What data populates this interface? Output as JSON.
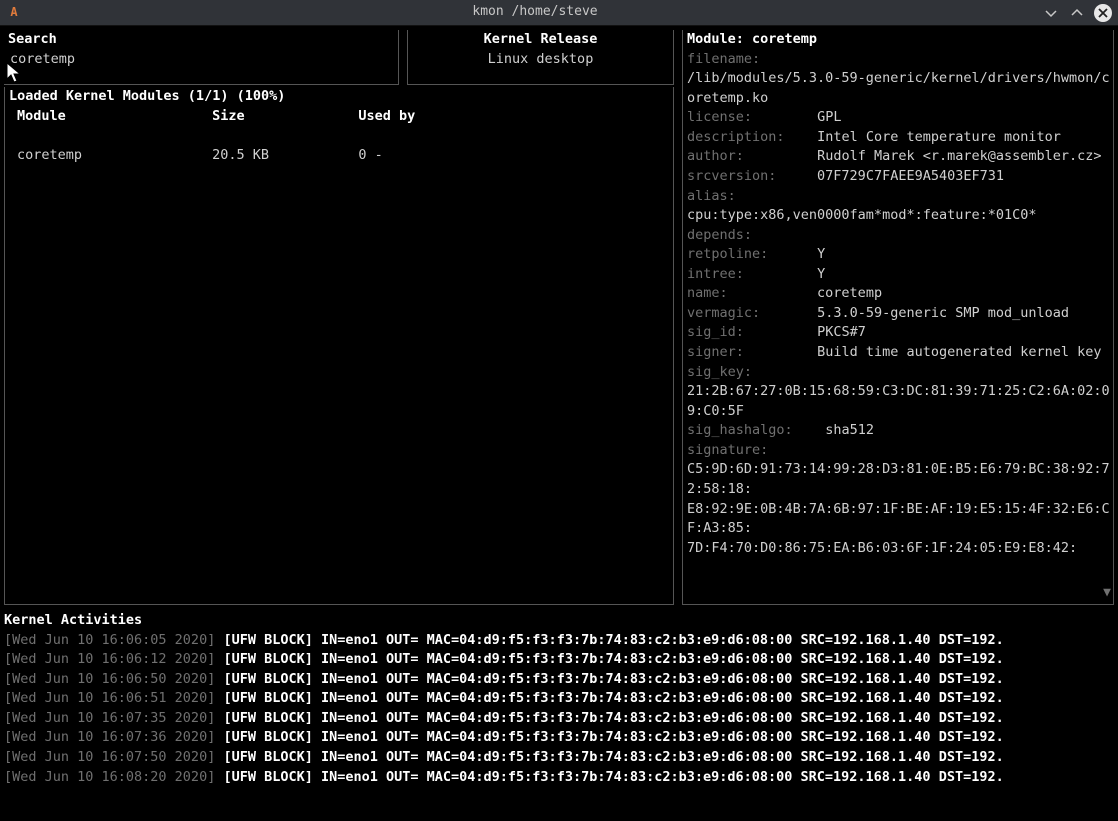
{
  "titlebar": {
    "app_icon_letter": "A",
    "title": "kmon /home/steve"
  },
  "search": {
    "label": "Search",
    "value": "coretemp"
  },
  "kernel_release": {
    "label": "Kernel Release",
    "value": "Linux desktop"
  },
  "modules_panel": {
    "label": "Loaded Kernel Modules (1/1) (100%)",
    "columns": {
      "c1": "Module",
      "c2": "Size",
      "c3": "Used by"
    },
    "rows": [
      {
        "name": "coretemp",
        "size": "20.5 KB",
        "used": "0 -"
      }
    ]
  },
  "module_detail": {
    "header": "Module: coretemp",
    "fields": {
      "filename_label": "filename:",
      "filename_value": "/lib/modules/5.3.0-59-generic/kernel/drivers/hwmon/coretemp.ko",
      "license_label": "license:",
      "license_value": "GPL",
      "description_label": "description:",
      "description_value": "Intel Core temperature monitor",
      "author_label": "author:",
      "author_value": "Rudolf Marek <r.marek@assembler.cz>",
      "srcversion_label": "srcversion:",
      "srcversion_value": "07F729C7FAEE9A5403EF731",
      "alias_label": "alias:",
      "alias_value": "cpu:type:x86,ven0000fam*mod*:feature:*01C0*",
      "depends_label": "depends:",
      "retpoline_label": "retpoline:",
      "retpoline_value": "Y",
      "intree_label": "intree:",
      "intree_value": "Y",
      "name_label": "name:",
      "name_value": "coretemp",
      "vermagic_label": "vermagic:",
      "vermagic_value": "5.3.0-59-generic SMP mod_unload",
      "sigid_label": "sig_id:",
      "sigid_value": "PKCS#7",
      "signer_label": "signer:",
      "signer_value": "Build time autogenerated kernel key",
      "sigkey_label": "sig_key:",
      "sigkey_value": "21:2B:67:27:0B:15:68:59:C3:DC:81:39:71:25:C2:6A:02:09:C0:5F",
      "sighash_label": "sig_hashalgo:",
      "sighash_value": "sha512",
      "signature_label": "signature:",
      "signature_value": "C5:9D:6D:91:73:14:99:28:D3:81:0E:B5:E6:79:BC:38:92:72:58:18:\nE8:92:9E:0B:4B:7A:6B:97:1F:BE:AF:19:E5:15:4F:32:E6:CF:A3:85:\n7D:F4:70:D0:86:75:EA:B6:03:6F:1F:24:05:E9:E8:42:"
    }
  },
  "activities": {
    "label": "Kernel Activities",
    "logs": [
      {
        "ts": "[Wed Jun 10 16:06:05 2020]",
        "msg": "[UFW BLOCK] IN=eno1 OUT= MAC=04:d9:f5:f3:f3:7b:74:83:c2:b3:e9:d6:08:00 SRC=192.168.1.40 DST=192."
      },
      {
        "ts": "[Wed Jun 10 16:06:12 2020]",
        "msg": "[UFW BLOCK] IN=eno1 OUT= MAC=04:d9:f5:f3:f3:7b:74:83:c2:b3:e9:d6:08:00 SRC=192.168.1.40 DST=192."
      },
      {
        "ts": "[Wed Jun 10 16:06:50 2020]",
        "msg": "[UFW BLOCK] IN=eno1 OUT= MAC=04:d9:f5:f3:f3:7b:74:83:c2:b3:e9:d6:08:00 SRC=192.168.1.40 DST=192."
      },
      {
        "ts": "[Wed Jun 10 16:06:51 2020]",
        "msg": "[UFW BLOCK] IN=eno1 OUT= MAC=04:d9:f5:f3:f3:7b:74:83:c2:b3:e9:d6:08:00 SRC=192.168.1.40 DST=192."
      },
      {
        "ts": "[Wed Jun 10 16:07:35 2020]",
        "msg": "[UFW BLOCK] IN=eno1 OUT= MAC=04:d9:f5:f3:f3:7b:74:83:c2:b3:e9:d6:08:00 SRC=192.168.1.40 DST=192."
      },
      {
        "ts": "[Wed Jun 10 16:07:36 2020]",
        "msg": "[UFW BLOCK] IN=eno1 OUT= MAC=04:d9:f5:f3:f3:7b:74:83:c2:b3:e9:d6:08:00 SRC=192.168.1.40 DST=192."
      },
      {
        "ts": "[Wed Jun 10 16:07:50 2020]",
        "msg": "[UFW BLOCK] IN=eno1 OUT= MAC=04:d9:f5:f3:f3:7b:74:83:c2:b3:e9:d6:08:00 SRC=192.168.1.40 DST=192."
      },
      {
        "ts": "[Wed Jun 10 16:08:20 2020]",
        "msg": "[UFW BLOCK] IN=eno1 OUT= MAC=04:d9:f5:f3:f3:7b:74:83:c2:b3:e9:d6:08:00 SRC=192.168.1.40 DST=192."
      }
    ]
  }
}
